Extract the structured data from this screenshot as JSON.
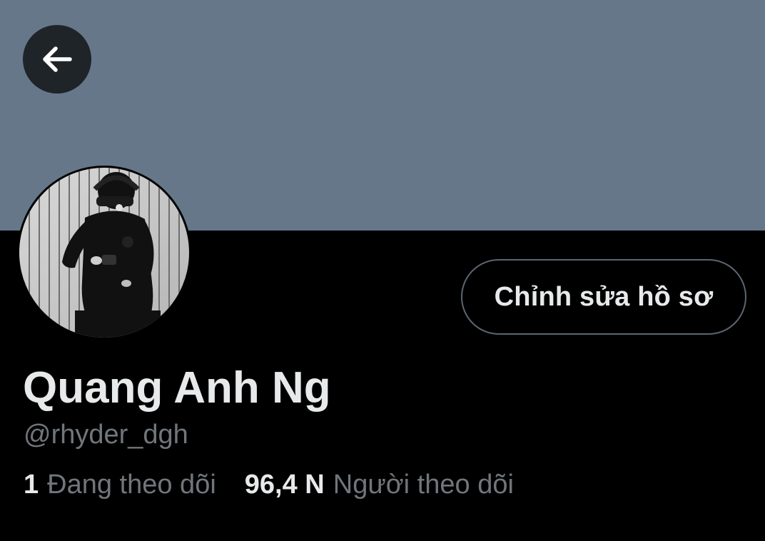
{
  "header": {
    "banner_color": "#66778a",
    "back_icon": "arrow-left-icon"
  },
  "profile": {
    "avatar_description": "avatar-photo",
    "edit_button_label": "Chỉnh sửa hồ sơ",
    "display_name": "Quang Anh Ng",
    "handle": "@rhyder_dgh",
    "stats": [
      {
        "count": "1",
        "label": "Đang theo dõi"
      },
      {
        "count": "96,4 N",
        "label": "Người theo dõi"
      }
    ]
  },
  "colors": {
    "background": "#000000",
    "text_primary": "#e7e9ea",
    "text_secondary": "#71767b",
    "button_border": "#5c6670"
  }
}
